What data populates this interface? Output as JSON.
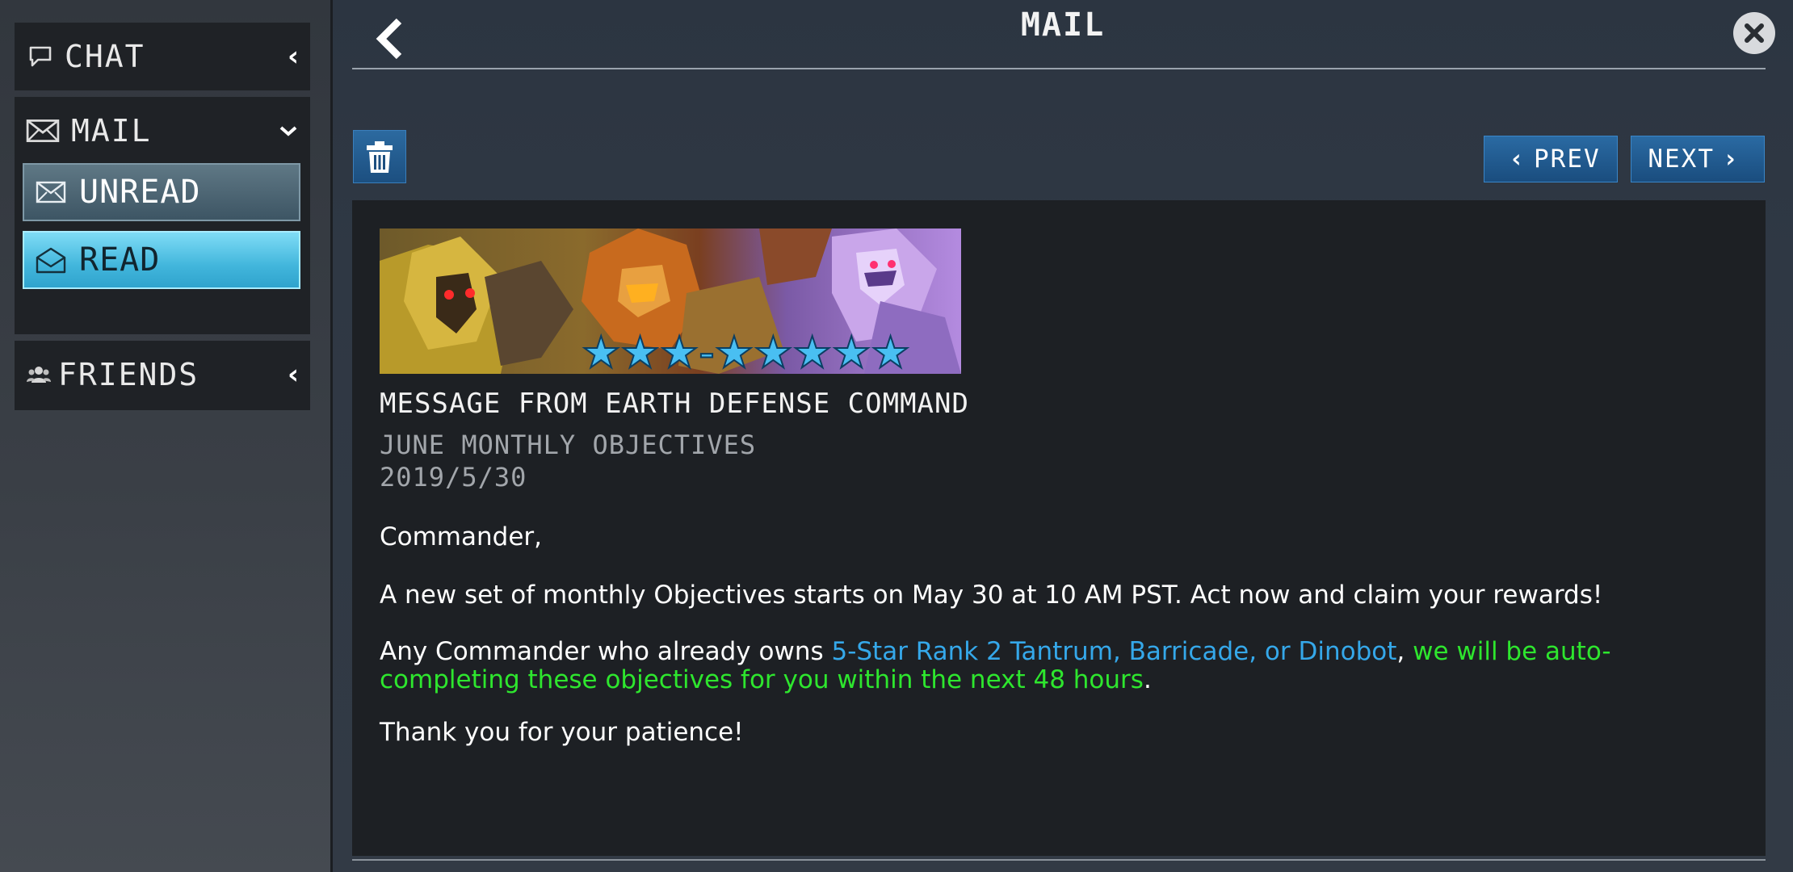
{
  "sidebar": {
    "chat": {
      "label": "CHAT"
    },
    "mail": {
      "label": "MAIL",
      "items": [
        {
          "label": "UNREAD"
        },
        {
          "label": "READ"
        }
      ]
    },
    "friends": {
      "label": "FRIENDS"
    }
  },
  "header": {
    "title": "MAIL"
  },
  "toolbar": {
    "prev_label": "PREV",
    "next_label": "NEXT"
  },
  "message": {
    "banner_stars": "★★★-★★★★★",
    "title": "MESSAGE FROM EARTH DEFENSE COMMAND",
    "subtitle": "JUNE MONTHLY OBJECTIVES",
    "date": "2019/5/30",
    "greeting": "Commander,",
    "paragraph_1": "A new set of monthly Objectives starts on May 30 at 10 AM PST. Act now and claim your rewards!",
    "paragraph_2_start": "Any Commander who already owns ",
    "paragraph_2_highlight": "5-Star Rank 2 Tantrum, Barricade, or Dinobot",
    "paragraph_2_mid": ", ",
    "paragraph_2_green": "we will be auto-completing these objectives for you within the next 48 hours",
    "paragraph_2_end": ".",
    "closing": "Thank you for your patience!"
  },
  "colors": {
    "accent_blue": "#35a8ea",
    "accent_green": "#2ee62e",
    "selected_tab": "#42b6dc"
  }
}
